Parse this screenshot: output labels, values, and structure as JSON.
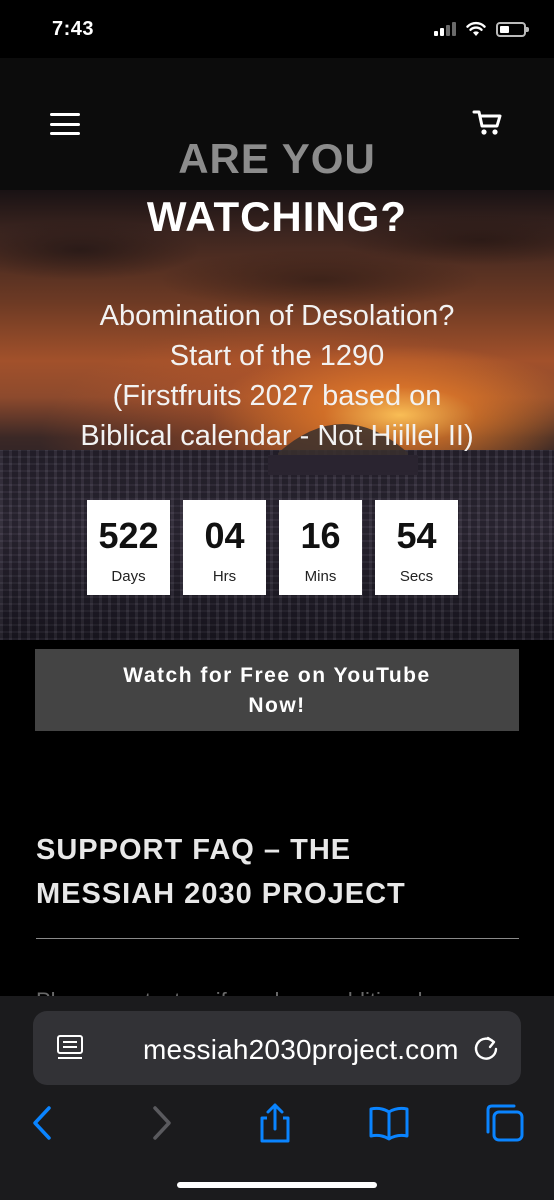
{
  "status_bar": {
    "time": "7:43",
    "icons": [
      "cellular-signal-icon",
      "wifi-icon",
      "battery-icon"
    ]
  },
  "header": {
    "menu_icon": "hamburger-menu-icon",
    "cart_icon": "shopping-cart-icon"
  },
  "hero": {
    "title_line1": "ARE YOU",
    "title_line2": "WATCHING?",
    "subtitle_lines": [
      "Abomination of Desolation?",
      "Start of the 1290",
      "(Firstfruits 2027 based on",
      "Biblical calendar - Not Hiillel II)"
    ],
    "countdown": [
      {
        "value": "522",
        "label": "Days"
      },
      {
        "value": "04",
        "label": "Hrs"
      },
      {
        "value": "16",
        "label": "Mins"
      },
      {
        "value": "54",
        "label": "Secs"
      }
    ]
  },
  "cta": {
    "label_line1": "Watch for Free on YouTube",
    "label_line2": "Now!"
  },
  "faq": {
    "heading_line1": "SUPPORT FAQ – THE",
    "heading_line2": "MESSIAH 2030 PROJECT",
    "body_peek": "Please contact us if you have additional"
  },
  "browser": {
    "url": "messiah2030project.com",
    "toolbar_icons": [
      "back-icon",
      "forward-icon",
      "share-icon",
      "bookmarks-icon",
      "tabs-icon"
    ]
  },
  "colors": {
    "page_background": "#000000",
    "cta_background": "#444444",
    "browser_accent": "#0a84ff",
    "title_dim": "#8c8c8c"
  }
}
